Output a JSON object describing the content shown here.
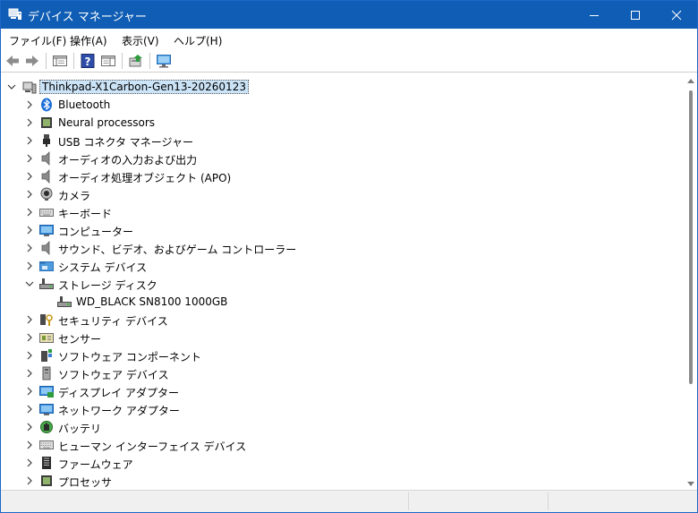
{
  "window": {
    "title": "デバイス マネージャー"
  },
  "menubar": {
    "items": [
      "ファイル(F)",
      "操作(A)",
      "表示(V)",
      "ヘルプ(H)"
    ]
  },
  "toolbar": {
    "buttons": [
      "back-icon",
      "forward-icon",
      "properties-icon",
      "help-icon",
      "show-hide-console-icon",
      "update-driver-icon",
      "scan-hardware-icon"
    ]
  },
  "tree": {
    "root": "Thinkpad-X1Carbon-Gen13-20260123",
    "items": [
      {
        "label": "Bluetooth",
        "icon": "bluetooth-icon",
        "expanded": false
      },
      {
        "label": "Neural processors",
        "icon": "chip-icon",
        "expanded": false
      },
      {
        "label": "USB コネクタ マネージャー",
        "icon": "usb-icon",
        "expanded": false
      },
      {
        "label": "オーディオの入力および出力",
        "icon": "speaker-icon",
        "expanded": false
      },
      {
        "label": "オーディオ処理オブジェクト (APO)",
        "icon": "speaker-icon",
        "expanded": false
      },
      {
        "label": "カメラ",
        "icon": "camera-icon",
        "expanded": false
      },
      {
        "label": "キーボード",
        "icon": "keyboard-icon",
        "expanded": false
      },
      {
        "label": "コンピューター",
        "icon": "computer-icon",
        "expanded": false
      },
      {
        "label": "サウンド、ビデオ、およびゲーム コントローラー",
        "icon": "speaker-icon",
        "expanded": false
      },
      {
        "label": "システム デバイス",
        "icon": "folder-icon",
        "expanded": false
      },
      {
        "label": "ストレージ ディスク",
        "icon": "disk-icon",
        "expanded": true,
        "children": [
          "WD_BLACK SN8100 1000GB"
        ]
      },
      {
        "label": "セキュリティ デバイス",
        "icon": "security-icon",
        "expanded": false
      },
      {
        "label": "センサー",
        "icon": "sensor-icon",
        "expanded": false
      },
      {
        "label": "ソフトウェア コンポーネント",
        "icon": "puzzle-icon",
        "expanded": false
      },
      {
        "label": "ソフトウェア デバイス",
        "icon": "software-device-icon",
        "expanded": false
      },
      {
        "label": "ディスプレイ アダプター",
        "icon": "display-adapter-icon",
        "expanded": false
      },
      {
        "label": "ネットワーク アダプター",
        "icon": "network-icon",
        "expanded": false
      },
      {
        "label": "バッテリ",
        "icon": "battery-icon",
        "expanded": false
      },
      {
        "label": "ヒューマン インターフェイス デバイス",
        "icon": "hid-icon",
        "expanded": false
      },
      {
        "label": "ファームウェア",
        "icon": "firmware-icon",
        "expanded": false
      },
      {
        "label": "プロセッサ",
        "icon": "chip-icon",
        "expanded": false
      }
    ]
  },
  "colors": {
    "titlebar": "#0f5db4",
    "selection": "#cce4f7"
  }
}
